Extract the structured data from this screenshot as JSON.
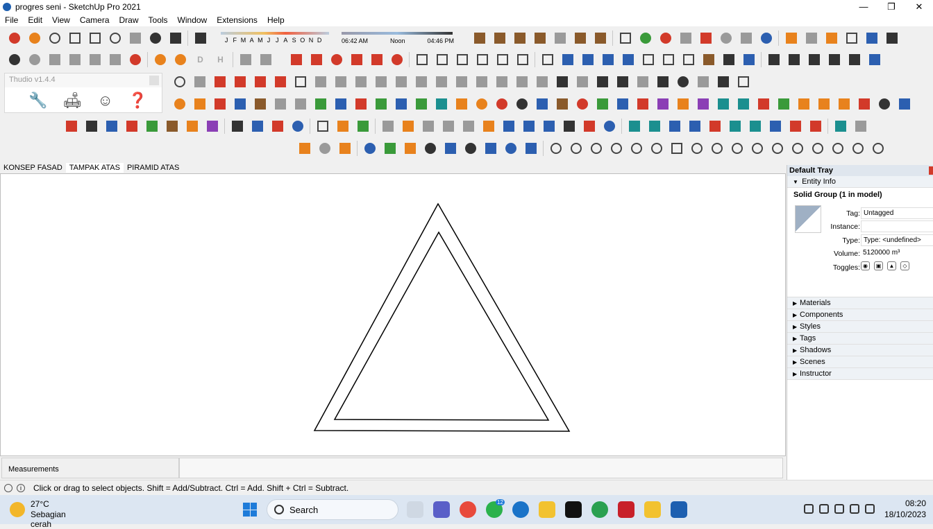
{
  "window": {
    "title": "progres seni - SketchUp Pro 2021",
    "controls": [
      "—",
      "❐",
      "✕"
    ]
  },
  "menu": [
    "File",
    "Edit",
    "View",
    "Camera",
    "Draw",
    "Tools",
    "Window",
    "Extensions",
    "Help"
  ],
  "shadow_settings": {
    "months": [
      "J",
      "F",
      "M",
      "A",
      "M",
      "J",
      "J",
      "A",
      "S",
      "O",
      "N",
      "D"
    ],
    "time_start": "06:42 AM",
    "time_mid": "Noon",
    "time_end": "04:46 PM"
  },
  "toolbar_letters": [
    "D",
    "H"
  ],
  "thudio": {
    "title": "Thudio v1.4.4",
    "icons": [
      "wrench-icon",
      "sofa-icon",
      "user-circle-icon",
      "help-icon"
    ]
  },
  "scene_tabs": [
    {
      "label": "KONSEP FASAD",
      "active": false
    },
    {
      "label": "TAMPAK ATAS",
      "active": true
    },
    {
      "label": "PIRAMID ATAS",
      "active": false
    }
  ],
  "tray": {
    "title": "Default Tray",
    "entity_info": {
      "header": "Entity Info",
      "title": "Solid Group (1 in model)",
      "tag_label": "Tag:",
      "tag_value": "Untagged",
      "instance_label": "Instance:",
      "instance_value": "",
      "type_label": "Type:",
      "type_value": "Type: <undefined>",
      "volume_label": "Volume:",
      "volume_value": "5120000 m³",
      "toggles_label": "Toggles:"
    },
    "sections": [
      "Materials",
      "Components",
      "Styles",
      "Tags",
      "Shadows",
      "Scenes",
      "Instructor"
    ]
  },
  "measurements": {
    "label": "Measurements",
    "value": ""
  },
  "status": {
    "text": "Click or drag to select objects. Shift = Add/Subtract. Ctrl = Add. Shift + Ctrl = Subtract."
  },
  "taskbar": {
    "weather_temp": "27°C",
    "weather_desc": "Sebagian cerah",
    "search_label": "Search",
    "badge_count": "12",
    "time": "08:20",
    "date": "18/10/2023"
  },
  "colors": {
    "accent": "#2c5fb0",
    "tray_header": "#dfe6ee",
    "taskbar": "#dce6f2"
  }
}
